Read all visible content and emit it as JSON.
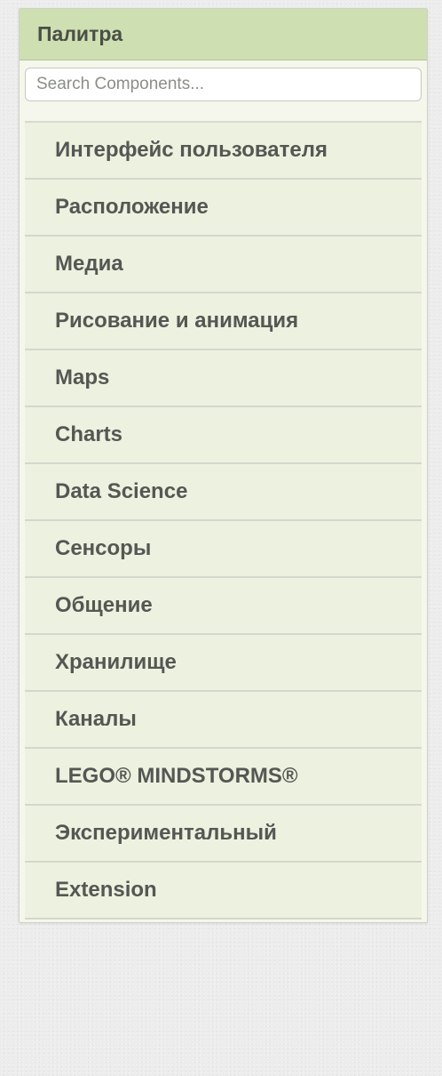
{
  "palette": {
    "title": "Палитра",
    "search": {
      "placeholder": "Search Components...",
      "value": ""
    },
    "categories": [
      {
        "label": "Интерфейс пользователя"
      },
      {
        "label": "Расположение"
      },
      {
        "label": "Медиа"
      },
      {
        "label": "Рисование и анимация"
      },
      {
        "label": "Maps"
      },
      {
        "label": "Charts"
      },
      {
        "label": "Data Science"
      },
      {
        "label": "Сенсоры"
      },
      {
        "label": "Общение"
      },
      {
        "label": "Хранилище"
      },
      {
        "label": "Каналы"
      },
      {
        "label": "LEGO® MINDSTORMS®"
      },
      {
        "label": "Экспериментальный"
      },
      {
        "label": "Extension"
      }
    ]
  },
  "colors": {
    "header_bg": "#cedfb2",
    "item_bg": "#edf1df",
    "text": "#545753"
  }
}
